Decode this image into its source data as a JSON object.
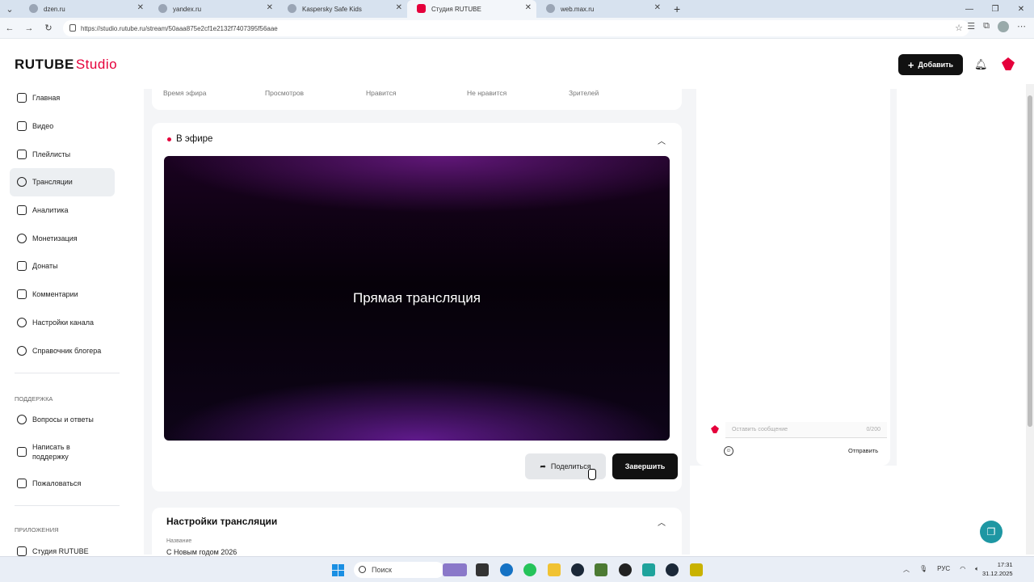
{
  "browser": {
    "tabs": [
      {
        "label": "dzen.ru"
      },
      {
        "label": "yandex.ru"
      },
      {
        "label": "Kaspersky Safe Kids"
      },
      {
        "label": "Студия RUTUBE"
      },
      {
        "label": "web.max.ru"
      }
    ],
    "active_tab_index": 3,
    "url": "https://studio.rutube.ru/stream/50aaa875e2cf1e2132f7407395f56aae"
  },
  "header": {
    "logo_main": "RUTUBE",
    "logo_studio": "Studio",
    "add_button": "Добавить"
  },
  "sidebar": {
    "items": [
      {
        "label": "Главная",
        "icon": "home-icon"
      },
      {
        "label": "Видео",
        "icon": "video-icon"
      },
      {
        "label": "Плейлисты",
        "icon": "playlist-icon"
      },
      {
        "label": "Трансляции",
        "icon": "broadcast-icon",
        "active": true
      },
      {
        "label": "Аналитика",
        "icon": "analytics-icon"
      },
      {
        "label": "Монетизация",
        "icon": "ruble-icon"
      },
      {
        "label": "Донаты",
        "icon": "donate-icon"
      },
      {
        "label": "Комментарии",
        "icon": "comments-icon"
      },
      {
        "label": "Настройки канала",
        "icon": "gear-icon"
      },
      {
        "label": "Справочник блогера",
        "icon": "info-icon"
      }
    ],
    "support_title": "ПОДДЕРЖКА",
    "support_items": [
      {
        "label": "Вопросы и ответы",
        "icon": "help-icon"
      },
      {
        "label": "Написать в поддержку",
        "icon": "mail-icon"
      },
      {
        "label": "Пожаловаться",
        "icon": "flag-icon"
      }
    ],
    "apps_title": "ПРИЛОЖЕНИЯ",
    "apps_items": [
      {
        "label": "Студия RUTUBE",
        "icon": "app-icon"
      }
    ]
  },
  "stats": {
    "labels": [
      "Время эфира",
      "Просмотров",
      "Нравится",
      "Не нравится",
      "Зрителей"
    ]
  },
  "live": {
    "title": "В эфире",
    "video_text": "Прямая трансляция",
    "share_button": "Поделиться",
    "end_button": "Завершить"
  },
  "settings": {
    "title": "Настройки трансляции",
    "name_label": "Название",
    "name_value": "С Новым годом 2026"
  },
  "chat": {
    "placeholder": "Оставить сообщение",
    "counter": "0/200",
    "send_label": "Отправить"
  },
  "taskbar": {
    "search_label": "Поиск",
    "lang": "РУС",
    "time": "17:31",
    "date": "31.12.2025"
  },
  "colors": {
    "brand": "#e5003b",
    "dark_button": "#111111",
    "accent_fab": "#1e97a3"
  }
}
